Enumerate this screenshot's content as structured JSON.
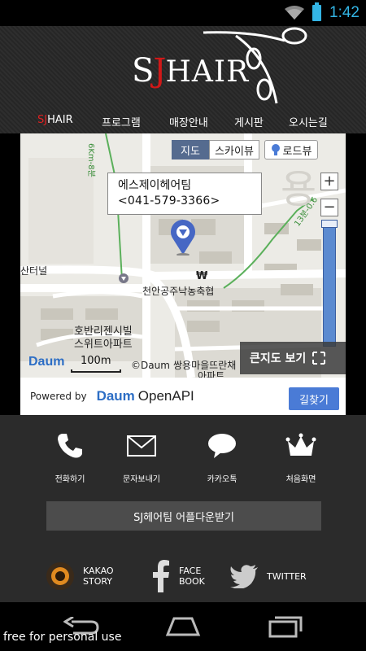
{
  "status_bar": {
    "time": "1:42"
  },
  "header": {
    "logo": {
      "s": "S",
      "j": "J",
      "hair": "HAIR"
    },
    "nav": [
      {
        "prefix": "SJ",
        "label": "HAIR"
      },
      {
        "label": "프로그램"
      },
      {
        "label": "매장안내"
      },
      {
        "label": "게시판"
      },
      {
        "label": "오시는길"
      }
    ]
  },
  "map": {
    "toggles": {
      "map": "지도",
      "sky": "스카이뷰",
      "road": "로드뷰"
    },
    "callout": {
      "name": "에스제이헤어팀",
      "phone": "<041-579-3366>"
    },
    "labels": {
      "bank": "천안공주낙농축협",
      "apt1": "호반리젠시빌",
      "apt2": "스위트아파트",
      "apt3": "쌍용마을뜨란채",
      "apt4": "아파트",
      "tunnel": "산터널",
      "won": "₩",
      "road1": "13분-0.6",
      "road2": "6Km-8분"
    },
    "bigmap_label": "큰지도 보기",
    "scale": "100m",
    "copyright": "©Daum",
    "daum_logo": "Daum"
  },
  "api_bar": {
    "powered": "Powered by",
    "logo": "Daum",
    "openapi": "OpenAPI",
    "route": "길찾기"
  },
  "actions": [
    {
      "label": "전화하기",
      "icon": "phone-icon"
    },
    {
      "label": "문자보내기",
      "icon": "mail-icon"
    },
    {
      "label": "카카오톡",
      "icon": "chat-bubble-icon"
    },
    {
      "label": "처음화면",
      "icon": "crown-icon"
    }
  ],
  "download_label": "SJ헤어팀 어플다운받기",
  "social": [
    {
      "line1": "KAKAO",
      "line2": "STORY"
    },
    {
      "line1": "FACE",
      "line2": "BOOK"
    },
    {
      "line1": "TWITTER",
      "line2": ""
    }
  ],
  "watermark": "free for personal use",
  "colors": {
    "accent": "#33b5e5",
    "brand_red": "#d01818",
    "map_button": "#4a7bd6"
  }
}
